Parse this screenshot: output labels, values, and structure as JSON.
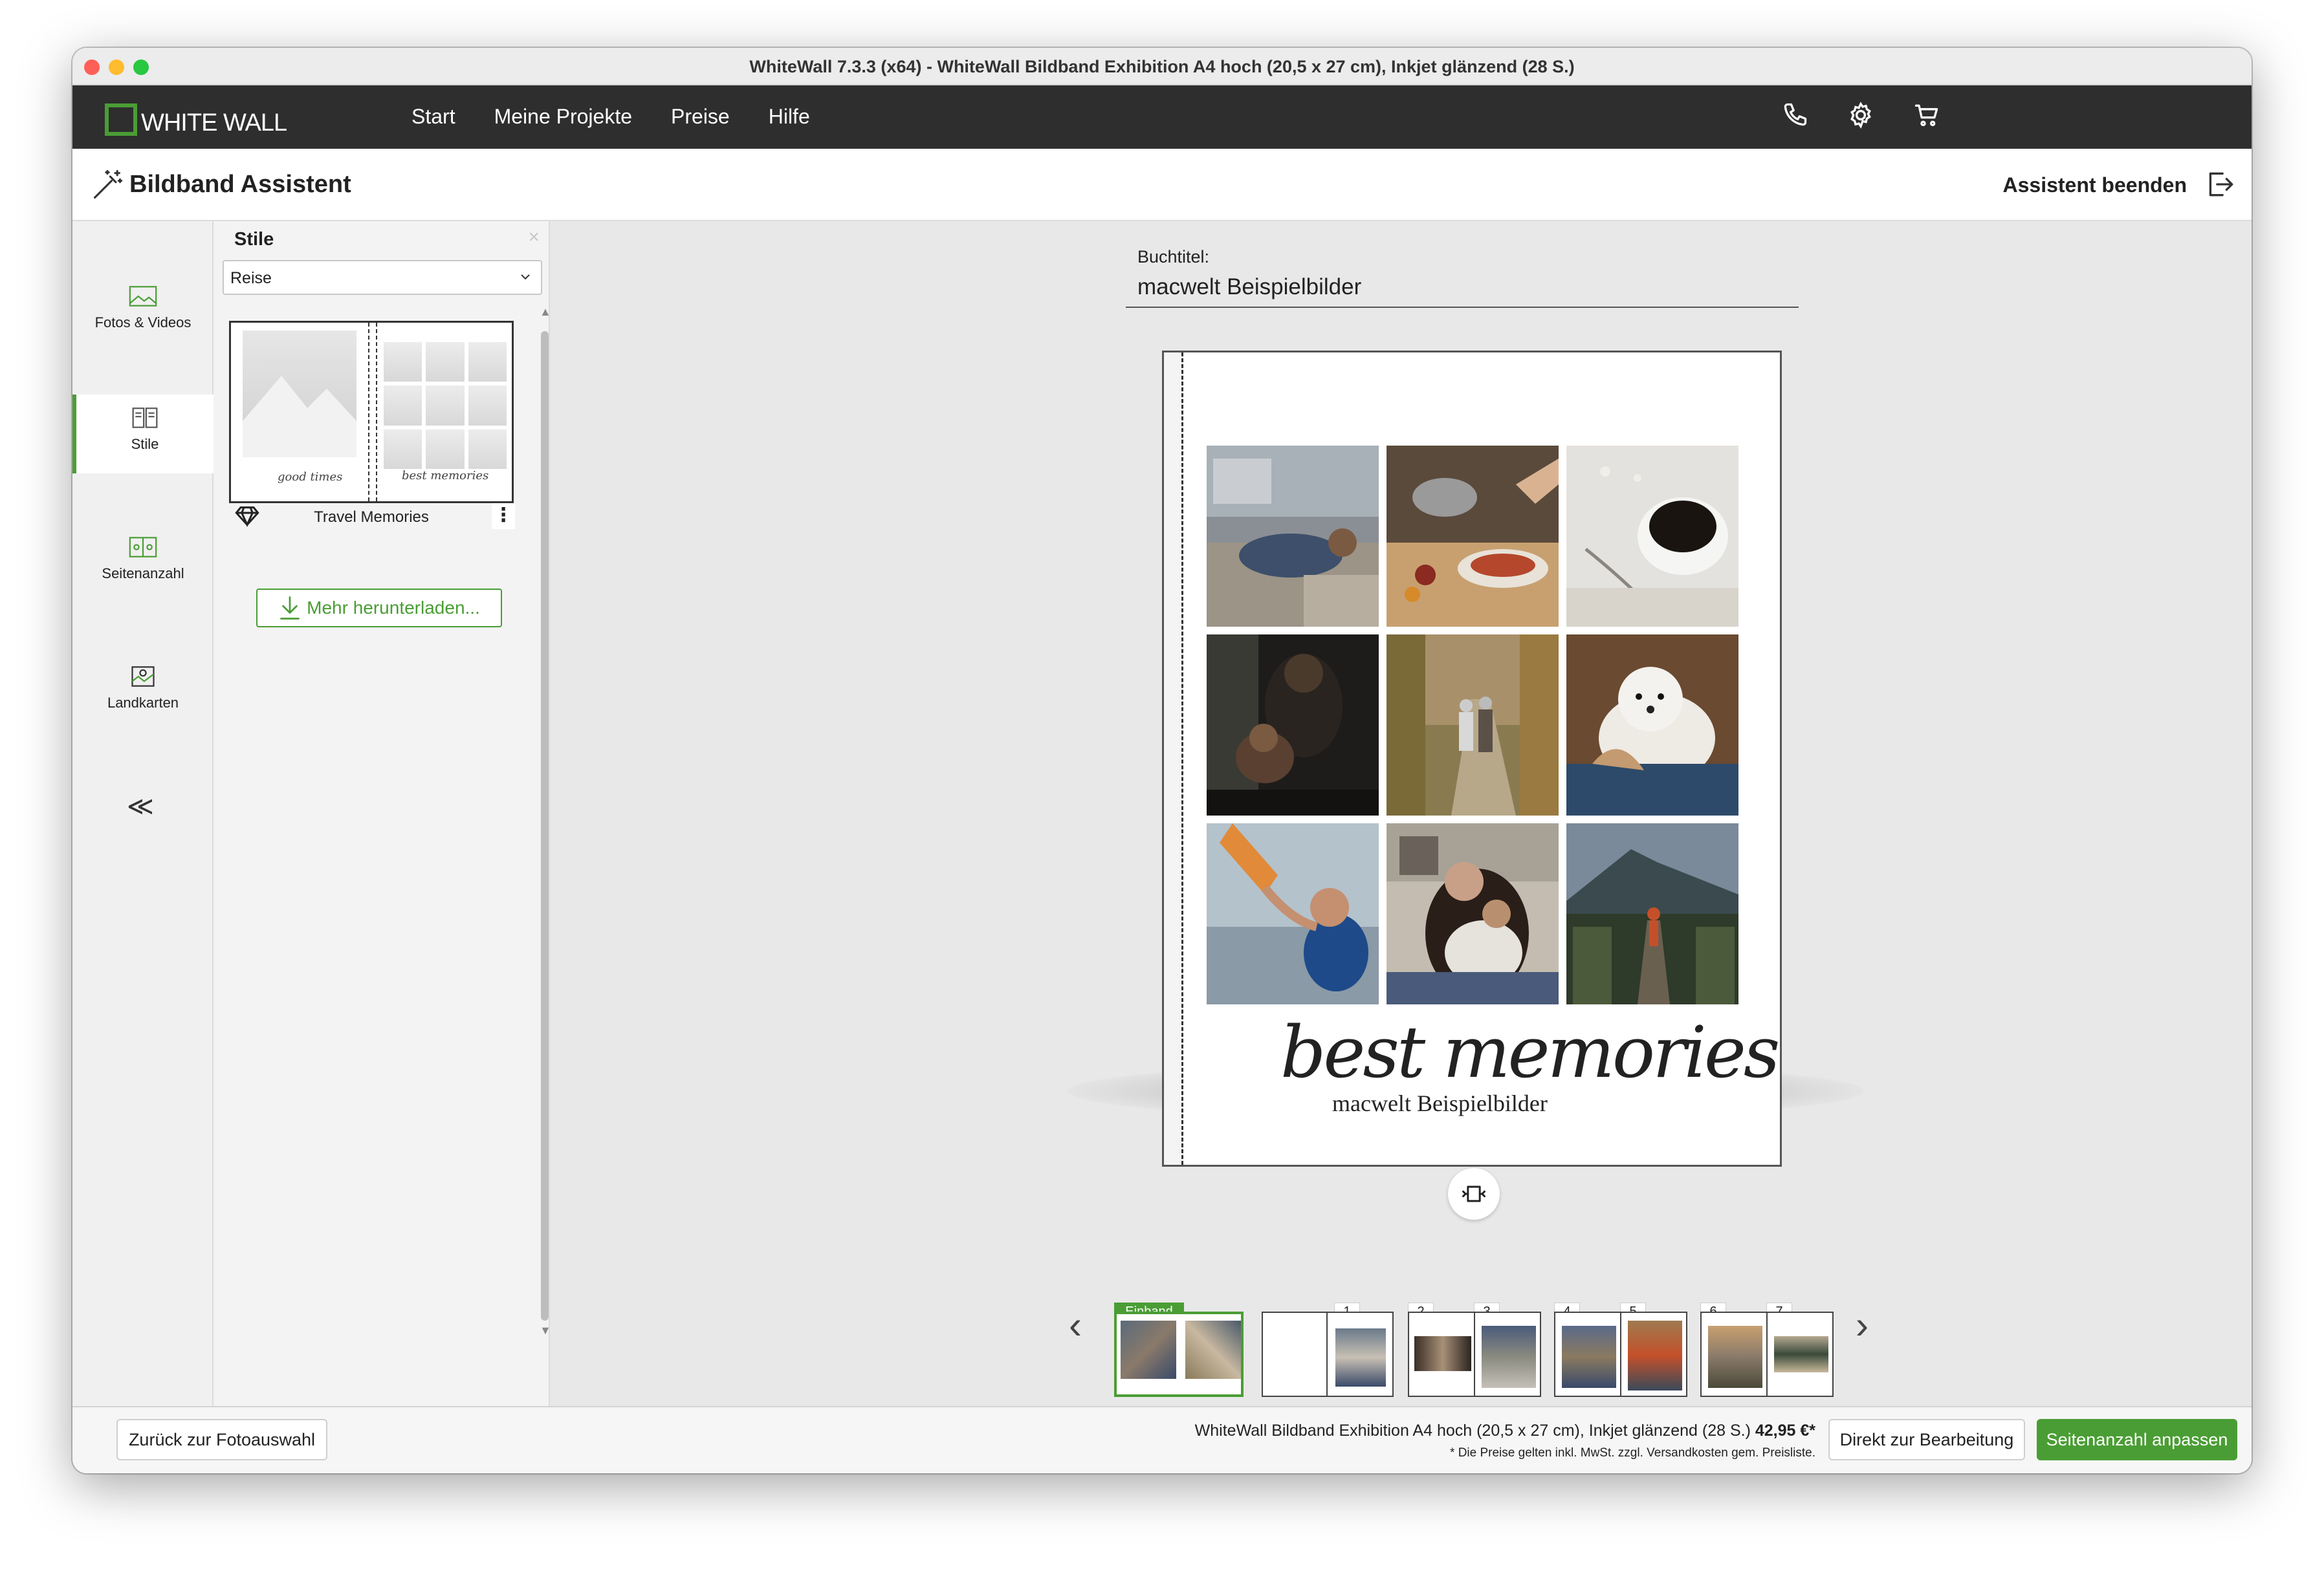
{
  "window": {
    "title": "WhiteWall 7.3.3 (x64) - WhiteWall Bildband Exhibition A4 hoch (20,5 x 27 cm), Inkjet glänzend (28 S.)"
  },
  "nav": {
    "logo_text": "WHITE WALL",
    "items": [
      "Start",
      "Meine Projekte",
      "Preise",
      "Hilfe"
    ],
    "icons": [
      "phone-icon",
      "gear-icon",
      "cart-icon"
    ]
  },
  "assistant": {
    "title": "Bildband Assistent",
    "end_label": "Assistent beenden"
  },
  "rail": {
    "items": [
      {
        "label": "Fotos & Videos",
        "icon": "photo-icon"
      },
      {
        "label": "Stile",
        "icon": "book-icon"
      },
      {
        "label": "Seitenanzahl",
        "icon": "pages-icon"
      },
      {
        "label": "Landkarten",
        "icon": "map-icon"
      }
    ],
    "active_index": 1,
    "collapse_glyph": "≪"
  },
  "panel": {
    "title": "Stile",
    "close": "×",
    "select_value": "Reise",
    "style_name": "Travel Memories",
    "style_left_script": "good times",
    "style_right_script": "best memories",
    "more_button": "Mehr herunterladen..."
  },
  "book": {
    "title_label": "Buchtitel:",
    "title_value": "macwelt Beispielbilder",
    "cover_script": "best memories",
    "cover_subtitle": "macwelt Beispielbilder"
  },
  "thumbnails": {
    "labels": [
      "Einband",
      "1",
      "2",
      "3",
      "4",
      "5",
      "6",
      "7"
    ],
    "prev": "‹",
    "next": "›"
  },
  "footer": {
    "back_button": "Zurück zur Fotoauswahl",
    "product": "WhiteWall Bildband Exhibition A4 hoch (20,5 x 27 cm), Inkjet glänzend (28 S.)",
    "price": "42,95 €*",
    "note": "* Die Preise gelten inkl. MwSt. zzgl. Versandkosten gem. Preisliste.",
    "edit_button": "Direkt zur Bearbeitung",
    "pages_button": "Seitenanzahl anpassen"
  },
  "colors": {
    "accent": "#4a9d34",
    "nav_bg": "#2e2e2e"
  }
}
